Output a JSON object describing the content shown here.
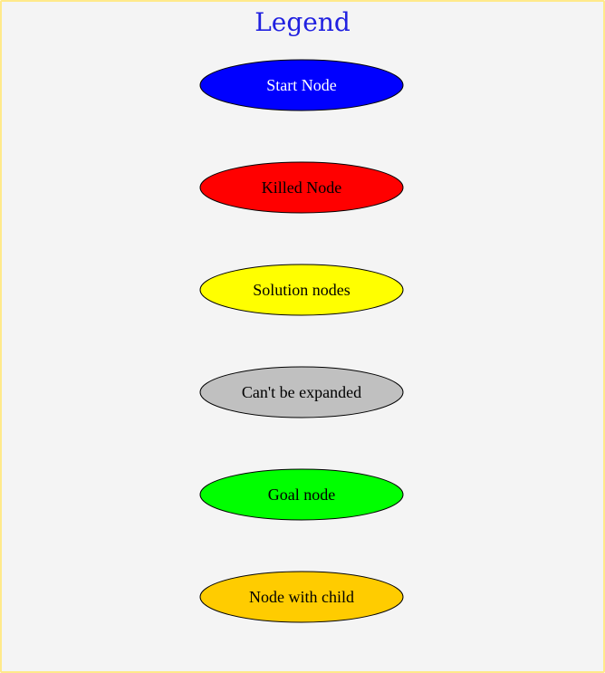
{
  "legend": {
    "title": "Legend",
    "title_color": "#2020e0",
    "items": [
      {
        "label": "Start Node",
        "fill": "#0000ff",
        "text_color": "#ffffff"
      },
      {
        "label": "Killed Node",
        "fill": "#ff0000",
        "text_color": "#000000"
      },
      {
        "label": "Solution nodes",
        "fill": "#ffff00",
        "text_color": "#000000"
      },
      {
        "label": "Can't be expanded",
        "fill": "#c0c0c0",
        "text_color": "#000000"
      },
      {
        "label": "Goal node",
        "fill": "#00ff00",
        "text_color": "#000000"
      },
      {
        "label": "Node with child",
        "fill": "#ffcc00",
        "text_color": "#000000"
      }
    ]
  },
  "colors": {
    "background": "#f4f4f4",
    "frame_border": "#ffe98a",
    "node_outline": "#000000"
  }
}
